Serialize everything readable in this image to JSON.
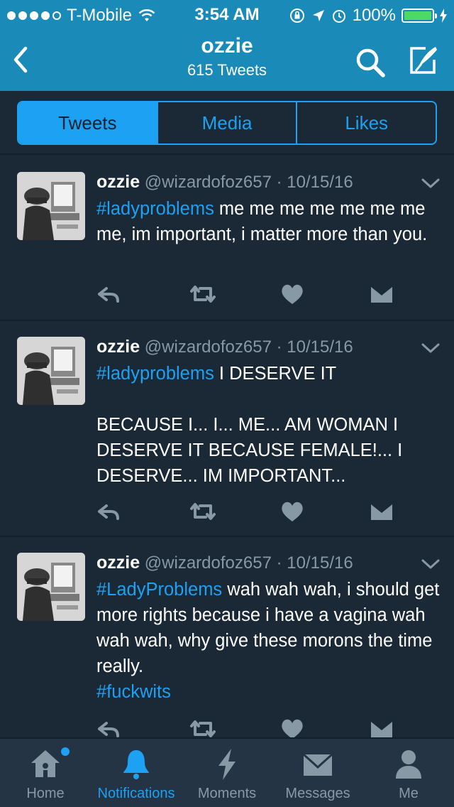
{
  "status_bar": {
    "carrier": "T-Mobile",
    "time": "3:54 AM",
    "battery": "100%"
  },
  "nav": {
    "title": "ozzie",
    "subtitle": "615 Tweets"
  },
  "segments": [
    "Tweets",
    "Media",
    "Likes"
  ],
  "selected_segment": "Tweets",
  "tweets": [
    {
      "name": "ozzie",
      "handle": "@wizardofoz657",
      "separator": "·",
      "date": "10/15/16",
      "hashtag": "#ladyproblems",
      "text": " me me me me me me me me, im important, i matter more than you.",
      "hashtag2": ""
    },
    {
      "name": "ozzie",
      "handle": "@wizardofoz657",
      "separator": "·",
      "date": "10/15/16",
      "hashtag": "#ladyproblems",
      "text": " I DESERVE IT\n\nBECAUSE I... I... ME... AM WOMAN I DESERVE IT BECAUSE FEMALE!... I DESERVE... IM IMPORTANT...",
      "hashtag2": ""
    },
    {
      "name": "ozzie",
      "handle": "@wizardofoz657",
      "separator": "·",
      "date": "10/15/16",
      "hashtag": "#LadyProblems",
      "text": " wah wah wah, i should get more rights because i have a vagina wah wah wah, why give these morons the time really.\n",
      "hashtag2": "#fuckwits"
    }
  ],
  "tabbar": {
    "items": [
      {
        "label": "Home",
        "icon": "home-icon"
      },
      {
        "label": "Notifications",
        "icon": "bell-icon"
      },
      {
        "label": "Moments",
        "icon": "lightning-icon"
      },
      {
        "label": "Messages",
        "icon": "envelope-icon"
      },
      {
        "label": "Me",
        "icon": "person-icon"
      }
    ],
    "active": "Notifications"
  },
  "colors": {
    "accent": "#1da1f2",
    "navbar": "#1a8ab8",
    "background": "#1b2836",
    "muted": "#8899a6",
    "battery": "#4cd964"
  }
}
